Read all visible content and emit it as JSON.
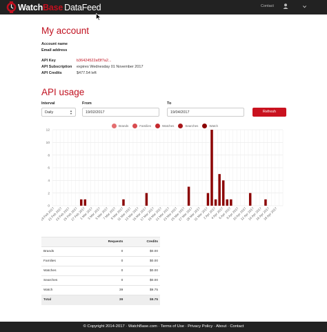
{
  "navbar": {
    "brand_watch": "Watch",
    "brand_base": "Base",
    "brand_datafeed": "DataFeed",
    "contact": "Contact",
    "user_icon": "user-icon",
    "menu_icon": "chevron-down-icon"
  },
  "account": {
    "title": "My account",
    "name_label": "Account name",
    "email_label": "Email address",
    "key_label": "API Key",
    "key_value": "b36424522af3f7a2...",
    "subscription_label": "API Subscription",
    "subscription_value": "expires Wednesday 01 November 2017",
    "credits_label": "API Credits",
    "credits_value": "$477.54 left"
  },
  "usage": {
    "title": "API usage",
    "interval_label": "Interval",
    "interval_value": "Daily",
    "from_label": "From",
    "from_value": "19/02/2017",
    "to_label": "To",
    "to_value": "19/04/2017",
    "refresh_label": "Refresh"
  },
  "colors": {
    "brand": "#c0101f",
    "navbar": "#222222",
    "series": [
      "#e46e70",
      "#d84b4f",
      "#c42a2e",
      "#a8171b",
      "#8b0000"
    ]
  },
  "chart_data": {
    "type": "bar",
    "stacked": true,
    "ylim": [
      0,
      12
    ],
    "yticks": [
      0,
      2,
      4,
      6,
      8,
      10,
      12
    ],
    "grid": true,
    "legend_position": "top",
    "categories": [
      "19 Feb 2017",
      "20 Feb 2017",
      "21 Feb 2017",
      "22 Feb 2017",
      "23 Feb 2017",
      "24 Feb 2017",
      "25 Feb 2017",
      "26 Feb 2017",
      "27 Feb 2017",
      "28 Feb 2017",
      "1 Mar 2017",
      "2 Mar 2017",
      "3 Mar 2017",
      "4 Mar 2017",
      "5 Mar 2017",
      "6 Mar 2017",
      "7 Mar 2017",
      "8 Mar 2017",
      "9 Mar 2017",
      "10 Mar 2017",
      "11 Mar 2017",
      "12 Mar 2017",
      "13 Mar 2017",
      "14 Mar 2017",
      "15 Mar 2017",
      "16 Mar 2017",
      "17 Mar 2017",
      "18 Mar 2017",
      "19 Mar 2017",
      "20 Mar 2017",
      "21 Mar 2017",
      "22 Mar 2017",
      "23 Mar 2017",
      "24 Mar 2017",
      "25 Mar 2017",
      "26 Mar 2017",
      "27 Mar 2017",
      "28 Mar 2017",
      "29 Mar 2017",
      "30 Mar 2017",
      "31 Mar 2017",
      "1 Apr 2017",
      "2 Apr 2017",
      "3 Apr 2017",
      "4 Apr 2017",
      "5 Apr 2017",
      "6 Apr 2017",
      "7 Apr 2017",
      "8 Apr 2017",
      "9 Apr 2017",
      "10 Apr 2017",
      "11 Apr 2017",
      "12 Apr 2017",
      "13 Apr 2017",
      "14 Apr 2017",
      "15 Apr 2017",
      "16 Apr 2017",
      "17 Apr 2017",
      "18 Apr 2017",
      "19 Apr 2017"
    ],
    "series": [
      {
        "name": "Brands",
        "values": [
          0,
          0,
          0,
          0,
          0,
          0,
          0,
          0,
          0,
          0,
          0,
          0,
          0,
          0,
          0,
          0,
          0,
          0,
          0,
          0,
          0,
          0,
          0,
          0,
          0,
          0,
          0,
          0,
          0,
          0,
          0,
          0,
          0,
          0,
          0,
          0,
          0,
          0,
          0,
          0,
          0,
          0,
          0,
          0,
          0,
          0,
          0,
          0,
          0,
          0,
          0,
          0,
          0,
          0,
          0,
          0,
          0,
          0,
          0,
          0
        ]
      },
      {
        "name": "Families",
        "values": [
          0,
          0,
          0,
          0,
          0,
          0,
          0,
          0,
          0,
          0,
          0,
          0,
          0,
          0,
          0,
          0,
          0,
          0,
          0,
          0,
          0,
          0,
          0,
          0,
          0,
          0,
          0,
          0,
          0,
          0,
          0,
          0,
          0,
          0,
          0,
          0,
          0,
          0,
          0,
          0,
          0,
          0,
          0,
          0,
          0,
          0,
          0,
          0,
          0,
          0,
          0,
          0,
          0,
          0,
          0,
          0,
          0,
          0,
          0,
          0
        ]
      },
      {
        "name": "Watches",
        "values": [
          0,
          0,
          0,
          0,
          0,
          0,
          0,
          0,
          0,
          0,
          0,
          0,
          0,
          0,
          0,
          0,
          0,
          0,
          0,
          0,
          0,
          0,
          0,
          0,
          0,
          0,
          0,
          0,
          0,
          0,
          0,
          0,
          0,
          0,
          0,
          0,
          0,
          0,
          0,
          0,
          0,
          0,
          0,
          0,
          0,
          0,
          0,
          0,
          0,
          0,
          0,
          0,
          0,
          0,
          0,
          0,
          0,
          0,
          0,
          0
        ]
      },
      {
        "name": "Searches",
        "values": [
          0,
          0,
          0,
          0,
          0,
          0,
          0,
          0,
          0,
          0,
          0,
          0,
          0,
          0,
          0,
          0,
          0,
          0,
          0,
          0,
          0,
          0,
          0,
          0,
          0,
          0,
          0,
          0,
          0,
          0,
          0,
          0,
          0,
          0,
          0,
          0,
          0,
          0,
          0,
          0,
          0,
          0,
          0,
          0,
          0,
          0,
          0,
          0,
          0,
          0,
          0,
          0,
          0,
          0,
          0,
          0,
          0,
          0,
          0,
          0
        ]
      },
      {
        "name": "Watch",
        "values": [
          0,
          0,
          0,
          0,
          0,
          0,
          0,
          1,
          1,
          0,
          0,
          0,
          0,
          0,
          0,
          0,
          0,
          0,
          1,
          0,
          0,
          0,
          0,
          0,
          2,
          0,
          0,
          0,
          0,
          0,
          0,
          0,
          0,
          0,
          0,
          3,
          0,
          0,
          0,
          0,
          2,
          12,
          1,
          5,
          4,
          1,
          1,
          0,
          0,
          0,
          0,
          2,
          0,
          0,
          0,
          1,
          0,
          0,
          0,
          0
        ]
      }
    ]
  },
  "table": {
    "headers": [
      "",
      "Requests",
      "Credits"
    ],
    "rows": [
      {
        "name": "Brands",
        "requests": "0",
        "credits": "$0.00"
      },
      {
        "name": "Families",
        "requests": "0",
        "credits": "$0.00"
      },
      {
        "name": "Watches",
        "requests": "0",
        "credits": "$0.00"
      },
      {
        "name": "Searches",
        "requests": "0",
        "credits": "$0.00"
      },
      {
        "name": "Watch",
        "requests": "39",
        "credits": "$9.75"
      }
    ],
    "total": {
      "name": "Total",
      "requests": "39",
      "credits": "$9.75"
    }
  },
  "footer": {
    "text": "© Copyright 2014-2017 · WatchBase.com · Terms of Use · Privacy Policy · About · Contact"
  }
}
